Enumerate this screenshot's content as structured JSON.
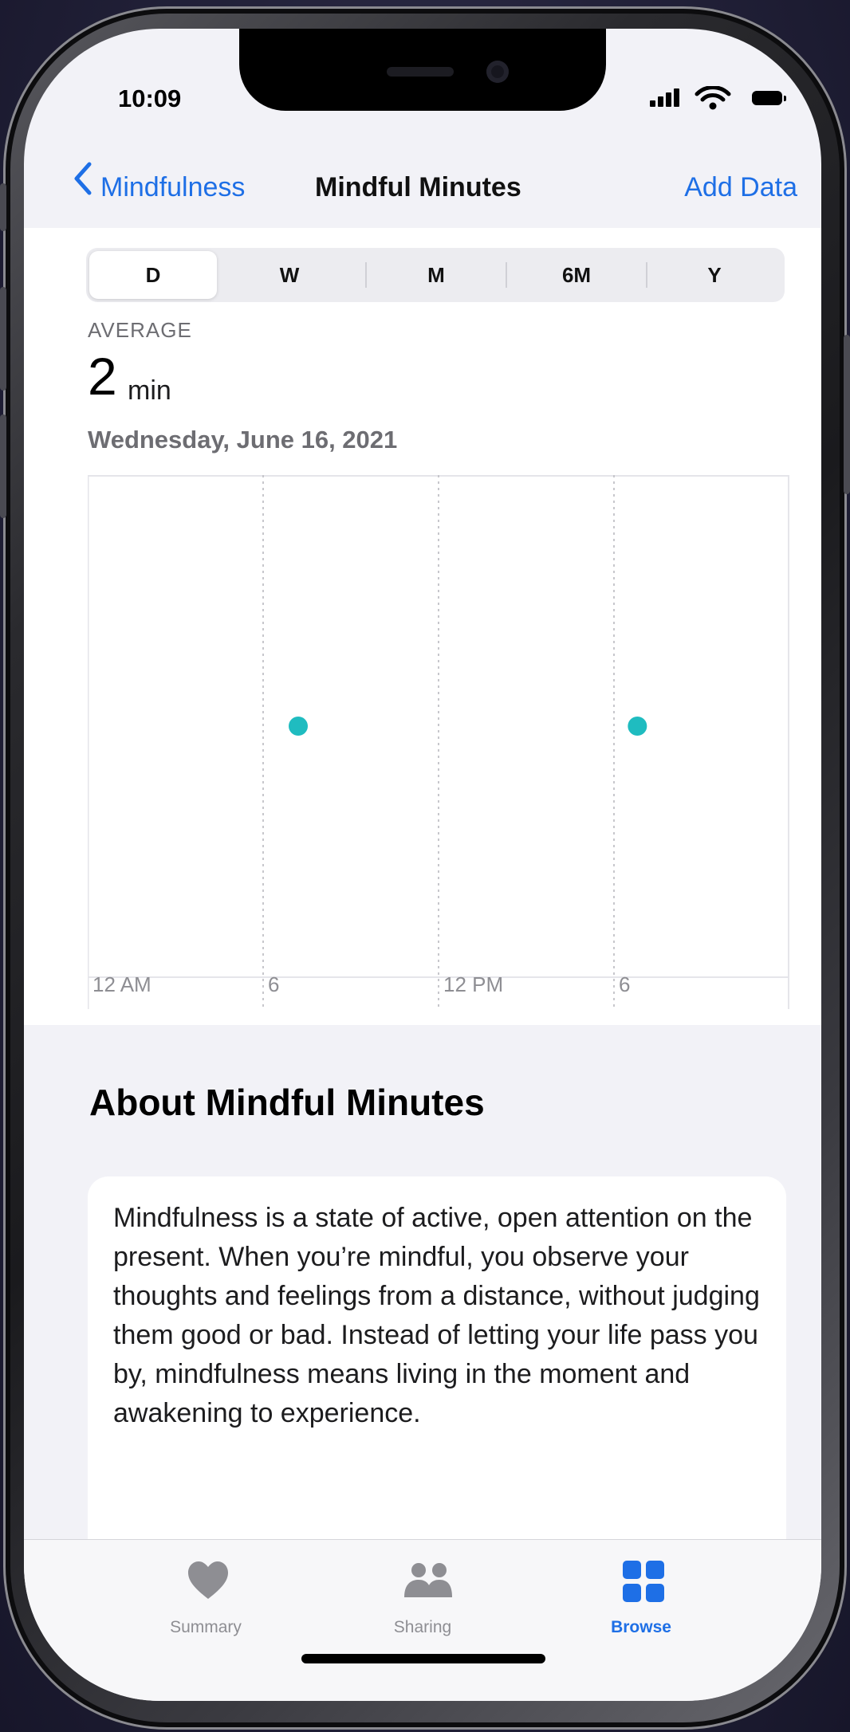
{
  "status": {
    "time": "10:09"
  },
  "nav": {
    "back_label": "Mindfulness",
    "title": "Mindful Minutes",
    "action": "Add Data"
  },
  "segments": [
    "D",
    "W",
    "M",
    "6M",
    "Y"
  ],
  "summary": {
    "label": "AVERAGE",
    "value": "2",
    "unit": "min",
    "date": "Wednesday, June 16, 2021"
  },
  "chart_data": {
    "type": "scatter",
    "x_tick_labels": [
      "12 AM",
      "6",
      "12 PM",
      "6"
    ],
    "x_range_hours": [
      0,
      24
    ],
    "points": [
      {
        "hour": 7.2,
        "minutes": 2
      },
      {
        "hour": 18.8,
        "minutes": 2
      }
    ],
    "y_range": [
      0,
      4
    ],
    "point_color": "#1fbcc0",
    "grid": "vertical-dotted"
  },
  "about": {
    "title": "About Mindful Minutes",
    "body": "Mindfulness is a state of active, open attention on the present. When you’re mindful, you observe your thoughts and feelings from a distance, without judging them good or bad. Instead of letting your life pass you by, mindfulness means living in the moment and awakening to experience."
  },
  "tabs": [
    {
      "label": "Summary",
      "icon": "heart-icon",
      "active": false
    },
    {
      "label": "Sharing",
      "icon": "people-icon",
      "active": false
    },
    {
      "label": "Browse",
      "icon": "grid-icon",
      "active": true
    }
  ],
  "colors": {
    "accent": "#1e6fe6",
    "chart_point": "#1fbcc0",
    "tab_inactive": "#8e8e93"
  }
}
